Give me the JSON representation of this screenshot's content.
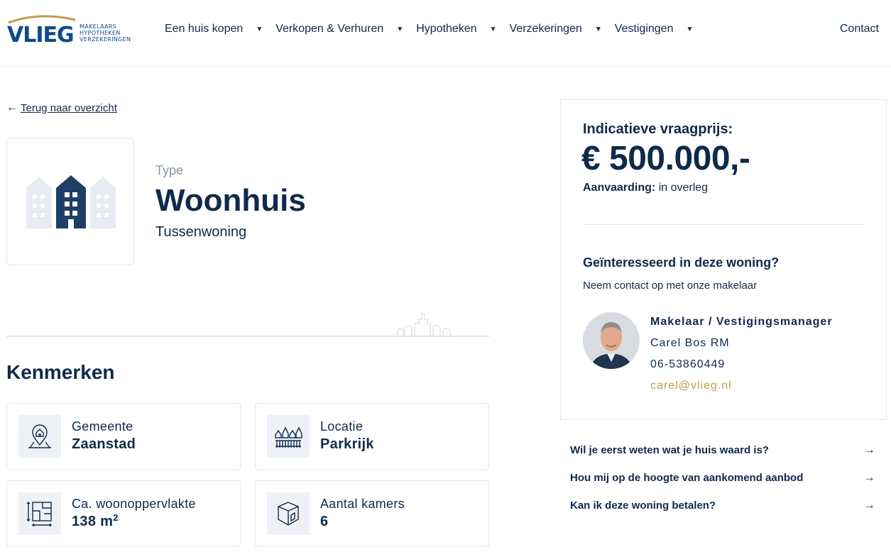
{
  "header": {
    "logo_word": "VLIEG",
    "logo_lines": [
      "MAKELAARS",
      "HYPOTHEKEN",
      "VERZEKERINGEN"
    ],
    "nav": [
      {
        "label": "Een huis kopen"
      },
      {
        "label": "Verkopen & Verhuren"
      },
      {
        "label": "Hypotheken"
      },
      {
        "label": "Verzekeringen"
      },
      {
        "label": "Vestigingen"
      }
    ],
    "contact": "Contact"
  },
  "back_link": "Terug naar overzicht",
  "type": {
    "label": "Type",
    "title": "Woonhuis",
    "subtitle": "Tussenwoning"
  },
  "kenmerken": {
    "heading": "Kenmerken",
    "items": [
      {
        "label": "Gemeente",
        "value": "Zaanstad",
        "icon": "location-house-icon"
      },
      {
        "label": "Locatie",
        "value": "Parkrijk",
        "icon": "houses-row-icon"
      },
      {
        "label": "Ca. woonoppervlakte",
        "value": "138 m",
        "unit_sup": "2",
        "icon": "floorplan-icon"
      },
      {
        "label": "Aantal kamers",
        "value": "6",
        "icon": "room-icon"
      }
    ]
  },
  "price": {
    "label": "Indicatieve vraagprijs:",
    "value": "€ 500.000,-",
    "acceptance_label": "Aanvaarding:",
    "acceptance_value": "in overleg"
  },
  "contact_card": {
    "heading": "Geïnteresseerd in deze woning?",
    "subheading": "Neem contact op met onze makelaar",
    "role": "Makelaar / Vestigingsmanager",
    "name": "Carel Bos RM",
    "phone": "06-53860449",
    "email": "carel@vlieg.nl"
  },
  "ctas": [
    {
      "label": "Wil je eerst weten wat je huis waard is?"
    },
    {
      "label": "Hou mij op de hoogte van aankomend aanbod"
    },
    {
      "label": "Kan ik deze woning betalen?"
    }
  ],
  "colors": {
    "navy": "#0f2a4a",
    "brand_blue": "#0f4a8a",
    "gold": "#c39b4f",
    "muted": "#8a97a8",
    "border": "#e4e7ec"
  }
}
